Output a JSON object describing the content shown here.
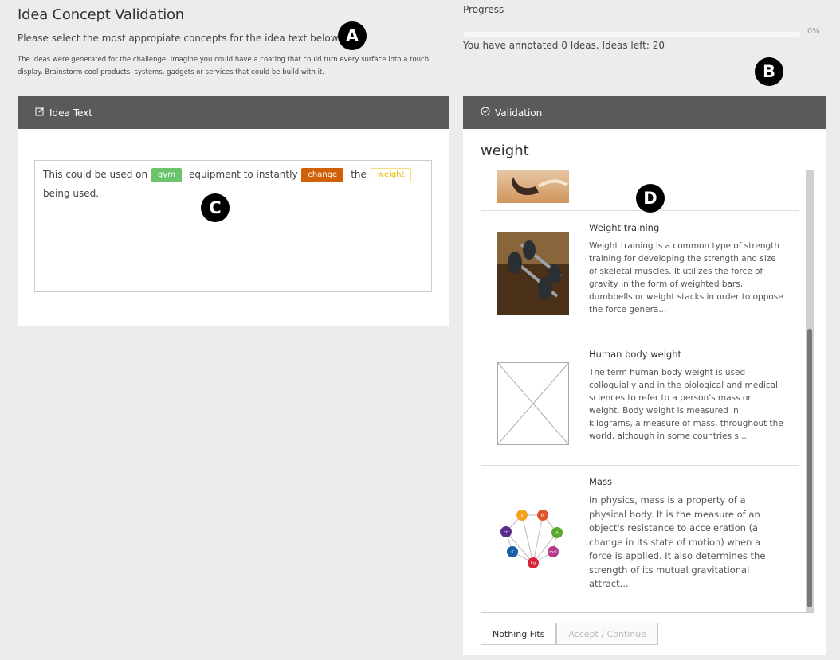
{
  "header": {
    "title": "Idea Concept Validation",
    "instruction": "Please select the most appropiate concepts for the idea text below.",
    "challenge": "The ideas were generated for the challenge: Imagine you could have a coating that could turn every surface into a touch display. Brainstorm cool products, systems, gadgets or services that could be build with it."
  },
  "progress": {
    "label": "Progress",
    "value": 0,
    "percent_text": "0%",
    "annotated_text": "You have annotated 0 Ideas. Ideas left: 20"
  },
  "markers": {
    "a": "A",
    "b": "B",
    "c": "C",
    "d": "D"
  },
  "idea_panel": {
    "header_icon": "edit-icon",
    "header_label": "Idea Text",
    "text_1": "This could be used on",
    "tag_1": "gym",
    "text_2": "equipment to instantly",
    "tag_2": "change",
    "text_3": "the",
    "tag_3": "weight",
    "text_4": "being used."
  },
  "validation_panel": {
    "header_icon": "check-circle-icon",
    "header_label": "Validation",
    "concept": "weight",
    "items": [
      {
        "title": "Weight training",
        "description": "Weight training is a common type of strength training for developing the strength and size of skeletal muscles. It utilizes the force of gravity in the form of weighted bars, dumbbells or weight stacks in order to oppose the force genera...",
        "image_icon": "dumbbell-photo"
      },
      {
        "title": "Human body weight",
        "description": "The term human body weight is used colloquially and in the biological and medical sciences to refer to a person's mass or weight. Body weight is measured in kilograms, a measure of mass, throughout the world, although in some countries s...",
        "image_icon": "placeholder-image-icon"
      },
      {
        "title": "Mass",
        "description": "In physics, mass is a property of a physical body. It is the measure of an object's resistance to acceleration (a change in its state of motion) when a force is applied. It also determines the strength of its mutual gravitational attract...",
        "image_icon": "si-units-diagram",
        "diagram_labels": [
          "s",
          "m",
          "A",
          "mol",
          "kg",
          "K",
          "cd"
        ]
      }
    ],
    "nothing_fits_label": "Nothing Fits",
    "accept_label": "Accept / Continue"
  },
  "colors": {
    "panel_header": "#5a5a5a",
    "tag_gym": "#6cc36c",
    "tag_change": "#d2600a",
    "tag_weight": "#e6b800"
  }
}
